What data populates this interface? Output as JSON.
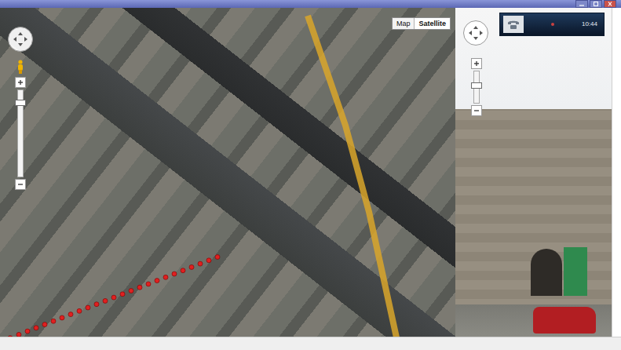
{
  "map_type": [
    {
      "label": "Map",
      "selected": false
    },
    {
      "label": "Satellite",
      "selected": true
    }
  ],
  "map_zoom": {
    "level": 0.88
  },
  "street_view_zoom": {
    "level": 0.6
  },
  "call_badge": {
    "time": "10:44"
  }
}
